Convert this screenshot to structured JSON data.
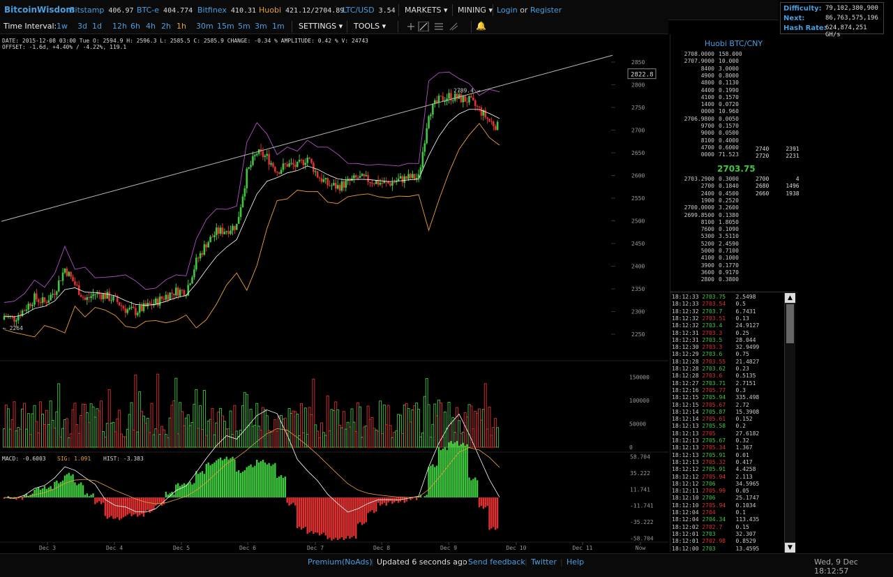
{
  "brand": "BitcoinWisdom",
  "tickers": [
    {
      "name": "Bitstamp",
      "value": "406.97",
      "color": "#4a9fe0"
    },
    {
      "name": "BTC-e",
      "value": "404.774",
      "color": "#4a9fe0"
    },
    {
      "name": "Bitfinex",
      "value": "410.31",
      "color": "#4a9fe0"
    },
    {
      "name": "Huobi",
      "value": "421.12/2704.89",
      "color": "#e8a13a"
    },
    {
      "name": "LTC/USD",
      "value": "3.54",
      "color": "#4a9fe0"
    }
  ],
  "menu": {
    "markets": "MARKETS",
    "mining": "MINING",
    "login": "Login",
    "or": "or",
    "register": "Register"
  },
  "difficulty": {
    "label": "Difficulty:",
    "value": "79,102,380,900",
    "next_label": "Next:",
    "next_value": "86,763,575,196",
    "hash_label": "Hash Rate:",
    "hash_value": "624,874,251 GH/s"
  },
  "toolbar": {
    "time_label": "Time Interval:",
    "intervals": [
      "1w",
      "3d",
      "1d",
      "12h",
      "6h",
      "4h",
      "2h",
      "1h",
      "30m",
      "15m",
      "5m",
      "3m",
      "1m"
    ],
    "active_interval": "1h",
    "settings": "SETTINGS",
    "tools": "TOOLS"
  },
  "info": {
    "line1": "DATE: 2015-12-08 03:00 Tue   O: 2594.9   H: 2596.3   L: 2585.5   C: 2585.9   CHANGE: -0.34 %   AMPLITUDE: 0.42 %   V: 24743",
    "line2": "OFFSET: -1.6d, +4.40% / -4.22%, 119.1"
  },
  "chart_data": {
    "type": "line",
    "title": "",
    "price_axis": [
      "2850",
      "2800",
      "2750",
      "2700",
      "2650",
      "2600",
      "2550",
      "2500",
      "2450",
      "2400",
      "2350",
      "2300",
      "2250"
    ],
    "volume_axis": [
      "150000",
      "100000",
      "50000",
      "0"
    ],
    "macd_axis": [
      "58.704",
      "35.222",
      "11.741",
      "-11.741",
      "-35.222",
      "-58.704"
    ],
    "x_labels": [
      "Dec 3",
      "Dec 4",
      "Dec 5",
      "Dec 6",
      "Dec 7",
      "Dec 8",
      "Dec 9",
      "Dec 10",
      "Dec 11",
      "Now"
    ],
    "price_box": "2822.8",
    "high_marker": "2789.4",
    "low_marker": "2264",
    "macd_legend": {
      "macd": "MACD: -0.6003",
      "sig": "SIG: 1.091",
      "hist": "HIST: -3.383"
    },
    "close": [
      2290,
      2285,
      2305,
      2330,
      2320,
      2345,
      2395,
      2360,
      2325,
      2340,
      2335,
      2325,
      2305,
      2300,
      2310,
      2320,
      2335,
      2345,
      2345,
      2410,
      2450,
      2475,
      2480,
      2490,
      2605,
      2650,
      2640,
      2610,
      2625,
      2620,
      2640,
      2600,
      2580,
      2575,
      2585,
      2595,
      2590,
      2585,
      2582,
      2590,
      2595,
      2595,
      2740,
      2765,
      2775,
      2770,
      2765,
      2745,
      2720,
      2705
    ]
  },
  "orderbook": {
    "title": "Huobi BTC/CNY",
    "asks": [
      [
        "2708.0000",
        "158.000"
      ],
      [
        "2707.9000",
        "10.000"
      ],
      [
        "8400",
        "3.0000"
      ],
      [
        "4900",
        "0.8000"
      ],
      [
        "4800",
        "0.1130"
      ],
      [
        "4400",
        "0.1990"
      ],
      [
        "4100",
        "0.1570"
      ],
      [
        "1400",
        "0.0720"
      ],
      [
        "0000",
        "10.960"
      ],
      [
        "2706.9800",
        "0.0050"
      ],
      [
        "9700",
        "0.1570"
      ],
      [
        "9000",
        "0.0500"
      ],
      [
        "8100",
        "0.4000"
      ],
      [
        "4700",
        "0.6000"
      ],
      [
        "0000",
        "71.523"
      ]
    ],
    "ask_sums": [
      [
        "2740",
        "2391"
      ],
      [
        "2720",
        "2231"
      ]
    ],
    "last_price": "2703.75",
    "bids": [
      [
        "2703.2900",
        "0.3000"
      ],
      [
        "2700",
        "0.1840"
      ],
      [
        "2400",
        "0.4500"
      ],
      [
        "1900",
        "0.2520"
      ],
      [
        "2700.0000",
        "3.2600"
      ],
      [
        "2699.8500",
        "0.1380"
      ],
      [
        "8100",
        "1.8050"
      ],
      [
        "7600",
        "0.1090"
      ],
      [
        "5300",
        "3.5110"
      ],
      [
        "5200",
        "2.4590"
      ],
      [
        "5000",
        "0.7100"
      ],
      [
        "4100",
        "0.1000"
      ],
      [
        "3900",
        "0.1770"
      ],
      [
        "3600",
        "0.9170"
      ],
      [
        "2800",
        "0.3800"
      ]
    ],
    "bid_sums": [
      [
        "2700",
        "4"
      ],
      [
        "2680",
        "1496"
      ],
      [
        "2660",
        "1938"
      ]
    ]
  },
  "trades": [
    [
      "18:12:33",
      "2703.75",
      "2.5498",
      "up"
    ],
    [
      "18:12:33",
      "2703.54",
      "0.5",
      "down"
    ],
    [
      "18:12:32",
      "2703.7",
      "6.7431",
      "up"
    ],
    [
      "18:12:32",
      "2703.51",
      "0.13",
      "down"
    ],
    [
      "18:12:32",
      "2703.4",
      "24.9127",
      "up"
    ],
    [
      "18:12:31",
      "2703.3",
      "0.25",
      "down"
    ],
    [
      "18:12:31",
      "2703.5",
      "28.044",
      "up"
    ],
    [
      "18:12:30",
      "2703.3",
      "32.9499",
      "down"
    ],
    [
      "18:12:29",
      "2703.6",
      "0.75",
      "up"
    ],
    [
      "18:12:28",
      "2703.55",
      "21.4827",
      "down"
    ],
    [
      "18:12:28",
      "2703.62",
      "0.23",
      "up"
    ],
    [
      "18:12:28",
      "2703.6",
      "0.5135",
      "down"
    ],
    [
      "18:12:27",
      "2703.71",
      "2.7151",
      "up"
    ],
    [
      "18:12:16",
      "2705.77",
      "0.3",
      "down"
    ],
    [
      "18:12:15",
      "2705.94",
      "335.498",
      "up"
    ],
    [
      "18:12:15",
      "2705.67",
      "2.72",
      "down"
    ],
    [
      "18:12:14",
      "2705.87",
      "15.3908",
      "up"
    ],
    [
      "18:12:14",
      "2705.61",
      "0.152",
      "down"
    ],
    [
      "18:12:13",
      "2705.58",
      "0.2",
      "up"
    ],
    [
      "18:12:13",
      "2705",
      "27.6182",
      "down"
    ],
    [
      "18:12:13",
      "2705.67",
      "0.32",
      "up"
    ],
    [
      "18:12:13",
      "2705.34",
      "1.367",
      "down"
    ],
    [
      "18:12:13",
      "2705.91",
      "0.01",
      "up"
    ],
    [
      "18:12:13",
      "2705.32",
      "0.417",
      "down"
    ],
    [
      "18:12:12",
      "2705.91",
      "4.4258",
      "up"
    ],
    [
      "18:12:12",
      "2705.94",
      "2.113",
      "down"
    ],
    [
      "18:12:12",
      "2706",
      "34.5965",
      "up"
    ],
    [
      "18:12:11",
      "2705.99",
      "0.05",
      "down"
    ],
    [
      "18:12:10",
      "2706",
      "25.1747",
      "up"
    ],
    [
      "18:12:10",
      "2705.94",
      "0.1034",
      "down"
    ],
    [
      "18:12:04",
      "2704",
      "0.1",
      "down"
    ],
    [
      "18:12:04",
      "2704.34",
      "113.435",
      "up"
    ],
    [
      "18:12:02",
      "2702.7",
      "0.15",
      "down"
    ],
    [
      "18:12:01",
      "2703",
      "32.307",
      "up"
    ],
    [
      "18:12:01",
      "2702.98",
      "0.8529",
      "down"
    ],
    [
      "18:12:00",
      "2703",
      "13.4595",
      "up"
    ]
  ],
  "footer": {
    "premium": "Premium(NoAds)",
    "updated": "Updated 6 seconds ago",
    "feedback": "Send feedback",
    "twitter": "Twitter",
    "help": "Help",
    "datetime": "Wed, 9 Dec 18:12:57"
  },
  "colors": {
    "up": "#3ec83e",
    "down": "#e03030",
    "accent": "#4a9fe0",
    "ema": "#ffffff",
    "boll_upper": "#b050c8",
    "boll_lower": "#f0a030"
  }
}
